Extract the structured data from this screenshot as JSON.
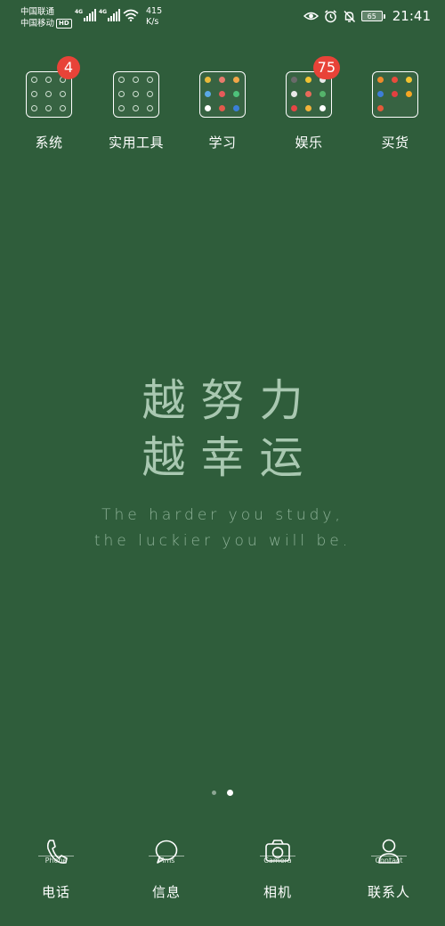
{
  "status_bar": {
    "carrier_1": "中国联通",
    "carrier_2": "中国移动",
    "hd_badge": "HD",
    "network_1": "4G",
    "network_2": "4G",
    "speed_value": "415",
    "speed_unit": "K/s",
    "battery": "65",
    "time": "21:41",
    "icons": [
      "eye-comfort-icon",
      "alarm-icon",
      "mute-bell-icon",
      "battery-icon"
    ]
  },
  "folders": [
    {
      "label": "系统",
      "badge": "4"
    },
    {
      "label": "实用工具",
      "badge": ""
    },
    {
      "label": "学习",
      "badge": ""
    },
    {
      "label": "娱乐",
      "badge": "75"
    },
    {
      "label": "买货",
      "badge": ""
    }
  ],
  "motto": {
    "line1": "越努力",
    "line2": "越幸运",
    "en_line1": "The harder you study,",
    "en_line2": "the luckier you will be."
  },
  "page_indicator": {
    "total": 2,
    "current": 2
  },
  "dock": [
    {
      "icon": "phone-icon",
      "caption": "Phone",
      "label": "电话"
    },
    {
      "icon": "message-bubble-icon",
      "caption": "Mms",
      "label": "信息"
    },
    {
      "icon": "camera-icon",
      "caption": "Camera",
      "label": "相机"
    },
    {
      "icon": "contact-person-icon",
      "caption": "Contact",
      "label": "联系人"
    }
  ],
  "colors": {
    "wallpaper": "#2f5d3b",
    "badge": "#e84338",
    "motto_text": "#a9c8b1"
  }
}
